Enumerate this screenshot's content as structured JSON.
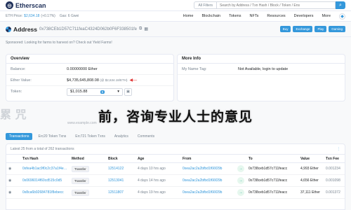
{
  "header": {
    "brand": "Etherscan",
    "search_filter": "All Filters",
    "search_placeholder": "Search by Address / Txn Hash / Block / Token / Ens",
    "eth_price_label": "ETH Price:",
    "eth_price_value": "$2,634.18",
    "eth_price_change": "(+0.17%)",
    "gas_label": "Gas: 6 Gwei",
    "nav": [
      "Home",
      "Blockchain",
      "Tokens",
      "NFTs",
      "Resources",
      "Developers",
      "More"
    ]
  },
  "address": {
    "title": "Address",
    "hash": "0x738CEb1D57C711feaC4324D062b0F6F338501fe",
    "buttons": [
      "Buy",
      "Exchange",
      "Play",
      "Gaming"
    ]
  },
  "sponsor": {
    "text": "Sponsored: Looking for farms to harvest on? Check out Yield Farms!",
    "link": "Yield Farms!"
  },
  "overview": {
    "title": "Overview",
    "balance_label": "Balance:",
    "balance_value": "0.00000000 Ether",
    "value_label": "Ether Value:",
    "value_value": "$4,735,645,808.08",
    "value_note": "(@ $2,634.18/ETH)",
    "token_label": "Token:",
    "token_value": "$1,015.88",
    "token_count": "8"
  },
  "more_info": {
    "title": "More Info",
    "tag_label": "My Name Tag:",
    "tag_value": "Not Available, login to update"
  },
  "watermark": {
    "text": "前，咨询专业人士的意见",
    "url": "www.example.com"
  },
  "tabs": [
    "Transactions",
    "Erc20 Token Txns",
    "Erc721 Token Txns",
    "Analytics",
    "Comments"
  ],
  "transactions": {
    "summary": "Latest 25 from a total of 262 transactions",
    "headers": [
      "Txn Hash",
      "Method",
      "Block",
      "Age",
      "From",
      "",
      "To",
      "Value",
      "Txn Fee"
    ],
    "rows": [
      {
        "hash": "0xfea4b1ac9f0c2c37a1f4e8b",
        "method": "Transfer",
        "block": "12514122",
        "age": "4 days 10 hrs ago",
        "from": "0xea2ac2a2bfbd1f66f29b",
        "dir": "IN",
        "to": "0x738ceb1d57c711feacc",
        "value": "4,993 Ether",
        "fee": "0.001234"
      },
      {
        "hash": "0x0696014f60cd515c0d5",
        "method": "Transfer",
        "block": "12513041",
        "age": "4 days 14 hrs ago",
        "from": "0xea2ac2a2bfbd1f66f29b",
        "dir": "IN",
        "to": "0x738ceb1d57c711feacc",
        "value": "4,656 Ether",
        "fee": "0.001098"
      },
      {
        "hash": "0x8ca6b92684781f8ebecc",
        "method": "Transfer",
        "block": "12511807",
        "age": "4 days 19 hrs ago",
        "from": "0xea2ac2a2bfbd1f66f29b",
        "dir": "IN",
        "to": "0x738ceb1d57c711feacc",
        "value": "37,111 Ether",
        "fee": "0.001372"
      }
    ]
  },
  "colors": {
    "brand": "#21325b",
    "accent": "#3498db",
    "in_badge": "#00a186"
  }
}
